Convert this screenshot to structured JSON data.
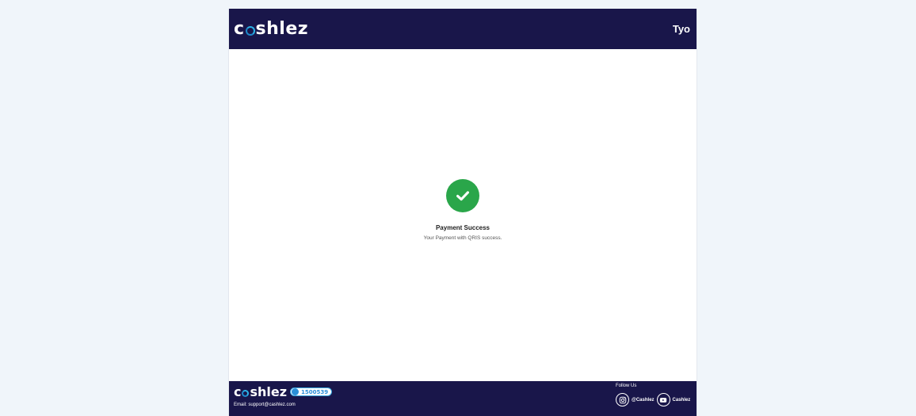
{
  "header": {
    "logo_pre": "c",
    "logo_post": "shlez",
    "user_name": "Tyo"
  },
  "status": {
    "icon": "check-circle-icon",
    "title": "Payment Success",
    "message": "Your Payment with QRIS success."
  },
  "footer": {
    "logo_pre": "c",
    "logo_post": "shlez",
    "hotline_number": "1500539",
    "email_text": "Email: support@cashlez.com",
    "follow_label": "Follow Us",
    "instagram_handle": "@Cashlez",
    "youtube_channel": "Cashlez"
  },
  "colors": {
    "navy": "#19164a",
    "success_green": "#2aa64a",
    "page_bg": "#f0f5fa",
    "logo_blue": "#2bb3e6"
  }
}
